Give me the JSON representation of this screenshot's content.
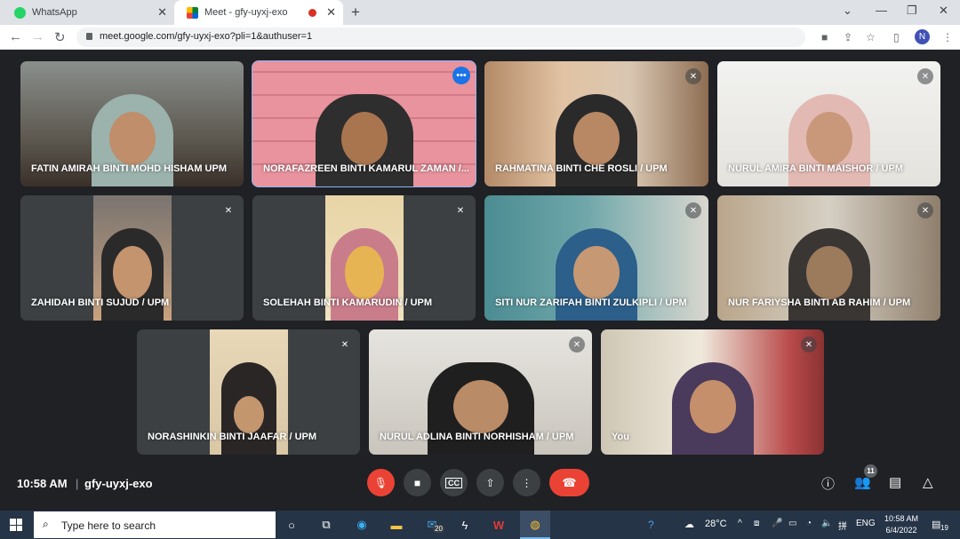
{
  "browser": {
    "tabs": [
      {
        "title": "WhatsApp",
        "active": false
      },
      {
        "title": "Meet - gfy-uyxj-exo",
        "active": true
      }
    ],
    "url": "meet.google.com/gfy-uyxj-exo?pli=1&authuser=1",
    "profile_initial": "N"
  },
  "meet": {
    "participants": [
      {
        "name": "FATIN AMIRAH BINTI MOHD HISHAM UPM",
        "muted": false,
        "speaking": false
      },
      {
        "name": "NORAFAZREEN BINTI KAMARUL ZAMAN /...",
        "muted": false,
        "speaking": true
      },
      {
        "name": "RAHMATINA BINTI CHE ROSLI / UPM",
        "muted": true,
        "speaking": false
      },
      {
        "name": "NURUL AMIRA BINTI MAISHOR / UPM",
        "muted": true,
        "speaking": false
      },
      {
        "name": "ZAHIDAH BINTI SUJUD / UPM",
        "muted": true,
        "speaking": false
      },
      {
        "name": "SOLEHAH BINTI KAMARUDIN / UPM",
        "muted": true,
        "speaking": false
      },
      {
        "name": "SITI NUR ZARIFAH BINTI ZULKIPLI / UPM",
        "muted": true,
        "speaking": false
      },
      {
        "name": "NUR FARIYSHA BINTI AB RAHIM / UPM",
        "muted": true,
        "speaking": false
      },
      {
        "name": "NORASHINKIN BINTI JAAFAR / UPM",
        "muted": true,
        "speaking": false
      },
      {
        "name": "NURUL ADLINA BINTI NORHISHAM / UPM",
        "muted": true,
        "speaking": false
      },
      {
        "name": "You",
        "muted": true,
        "speaking": false
      }
    ],
    "time": "10:58 AM",
    "separator": "|",
    "meeting_code": "gfy-uyxj-exo",
    "participant_count": "11",
    "colors": {
      "hangup": "#ea4335",
      "accent": "#1a73e8",
      "background": "#202124"
    }
  },
  "taskbar": {
    "search_placeholder": "Type here to search",
    "mail_badge": "20",
    "weather": "28°C",
    "language": "ENG",
    "clock_time": "10:58 AM",
    "clock_date": "6/4/2022",
    "notifications": "19"
  }
}
